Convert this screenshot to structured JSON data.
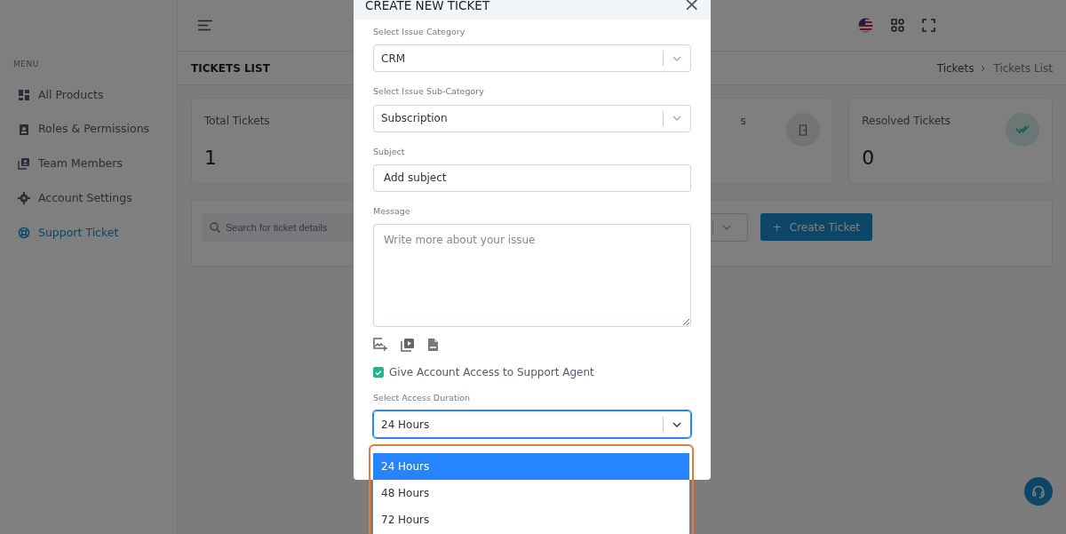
{
  "sidebar": {
    "menu_label": "MENU",
    "items": [
      {
        "label": "All Products",
        "selected": false
      },
      {
        "label": "Roles & Permissions",
        "selected": false
      },
      {
        "label": "Team Members",
        "selected": false
      },
      {
        "label": "Account Settings",
        "selected": false
      },
      {
        "label": "Support Ticket",
        "selected": true
      }
    ]
  },
  "page": {
    "title": "TICKETS LIST",
    "breadcrumb": [
      "Tickets",
      "Tickets List"
    ],
    "stats": [
      {
        "title": "Total Tickets",
        "value": "1"
      },
      {
        "title": "s"
      },
      {
        "title": "Resolved Tickets",
        "value": "0"
      }
    ],
    "search": {
      "placeholder": "Search for ticket details"
    },
    "create_button": "Create Ticket",
    "create_icon": "+"
  },
  "modal": {
    "title": "CREATE NEW TICKET",
    "close": "×",
    "category": {
      "label": "Select Issue Category",
      "value": "CRM"
    },
    "sub_category": {
      "label": "Select Issue Sub-Category",
      "value": "Subscription"
    },
    "subject": {
      "label": "Subject",
      "placeholder": "Add subject"
    },
    "message": {
      "label": "Message",
      "placeholder": "Write more about your issue"
    },
    "access": {
      "label": "Give Account Access to Support Agent",
      "checked": true
    },
    "duration": {
      "label": "Select Access Duration",
      "value": "24 Hours",
      "expanded": true,
      "options": [
        {
          "label": "24 Hours",
          "selected": true
        },
        {
          "label": "48 Hours",
          "selected": false
        },
        {
          "label": "72 Hours",
          "selected": false
        }
      ]
    }
  }
}
